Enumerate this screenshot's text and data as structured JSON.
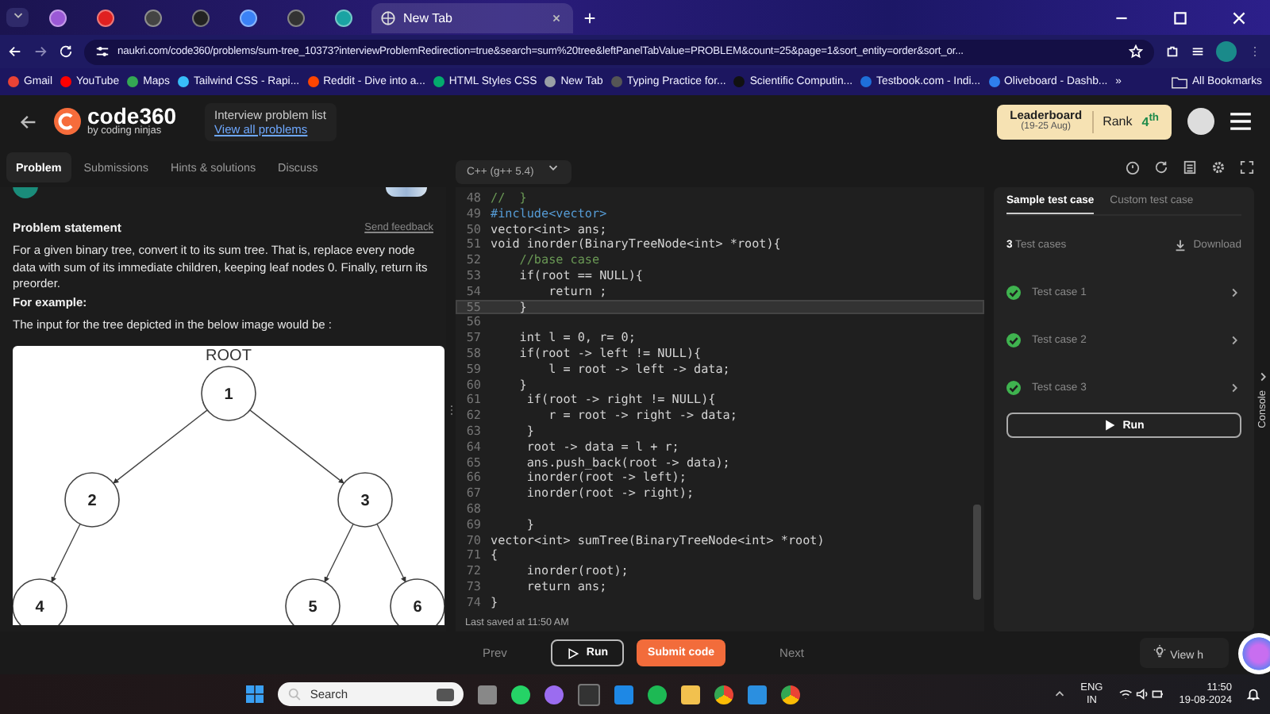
{
  "browser": {
    "tabs": [
      {
        "kind": "pinned",
        "color": "#9b59d6",
        "selected": false
      },
      {
        "kind": "pinned",
        "color": "#e02020",
        "selected": false
      },
      {
        "kind": "pinned",
        "color": "#444444",
        "selected": false
      },
      {
        "kind": "pinned",
        "color": "#222222",
        "selected": false
      },
      {
        "kind": "pinned",
        "color": "#3b82f6",
        "selected": false
      },
      {
        "kind": "pinned",
        "color": "#333333",
        "selected": false
      },
      {
        "kind": "pinned",
        "color": "#1aa3a3",
        "selected": false
      },
      {
        "kind": "page",
        "title": "New Tab",
        "selected": true
      }
    ],
    "url": "naukri.com/code360/problems/sum-tree_10373?interviewProblemRedirection=true&search=sum%20tree&leftPanelTabValue=PROBLEM&count=25&page=1&sort_entity=order&sort_or...",
    "bookmarks": [
      {
        "label": "Gmail",
        "color": "#ea4335"
      },
      {
        "label": "YouTube",
        "color": "#ff0000"
      },
      {
        "label": "Maps",
        "color": "#34a853"
      },
      {
        "label": "Tailwind CSS - Rapi...",
        "color": "#38bdf8"
      },
      {
        "label": "Reddit - Dive into a...",
        "color": "#ff4500"
      },
      {
        "label": "HTML Styles CSS",
        "color": "#04aa6d"
      },
      {
        "label": "New Tab",
        "color": "#9aa0a6"
      },
      {
        "label": "Typing Practice for...",
        "color": "#555555"
      },
      {
        "label": "Scientific Computin...",
        "color": "#111111"
      },
      {
        "label": "Testbook.com - Indi...",
        "color": "#1e6fd9"
      },
      {
        "label": "Oliveboard - Dashb...",
        "color": "#2f80ed"
      }
    ],
    "more": "»",
    "all_bookmarks": "All Bookmarks"
  },
  "header": {
    "logo_main": "code",
    "logo_num": "360",
    "logo_sub": "by coding ninjas",
    "breadcrumb": "Interview problem list",
    "link": "View all problems",
    "leaderboard": "Leaderboard",
    "dates": "(19-25 Aug)",
    "rank_label": "Rank",
    "rank": "4$^{th}$"
  },
  "left_tabs": [
    {
      "label": "Problem",
      "selected": true
    },
    {
      "label": "Submissions",
      "selected": false
    },
    {
      "label": "Hints & solutions",
      "selected": false
    },
    {
      "label": "Discuss",
      "selected": false
    }
  ],
  "problem": {
    "heading": "Problem statement",
    "feedback": "Send feedback",
    "body": "For a given binary tree, convert it to its sum tree. That is, replace every node data with sum of its immediate children, keeping leaf nodes 0. Finally, return its preorder.",
    "example_heading": "For example:",
    "example_text": "The input for the tree depicted in the below image would be :",
    "tree_caption": "ROOT",
    "tree": {
      "label": "1",
      "children": [
        {
          "label": "2",
          "children": [
            {
              "label": "4"
            }
          ]
        },
        {
          "label": "3",
          "children": [
            {
              "label": "5"
            },
            {
              "label": "6"
            }
          ]
        }
      ]
    }
  },
  "editor": {
    "language": "C++ (g++ 5.4)",
    "lines": [
      {
        "n": "48",
        "text": "//  }",
        "kind": "comment",
        "current": false
      },
      {
        "n": "49",
        "text": "#include<vector>",
        "kind": "directive",
        "current": false
      },
      {
        "n": "50",
        "text": "vector<int> ans;",
        "kind": "code",
        "current": false
      },
      {
        "n": "51",
        "text": "void inorder(BinaryTreeNode<int> *root){",
        "kind": "code",
        "current": false
      },
      {
        "n": "52",
        "text": "    //base case",
        "kind": "comment",
        "current": false
      },
      {
        "n": "53",
        "text": "    if(root == NULL){",
        "kind": "code",
        "current": false
      },
      {
        "n": "54",
        "text": "        return ;",
        "kind": "code",
        "current": false
      },
      {
        "n": "55",
        "text": "    }",
        "kind": "code",
        "current": true
      },
      {
        "n": "56",
        "kind": "code",
        "current": false
      },
      {
        "n": "57",
        "text": "    int l = 0, r= 0;",
        "kind": "code",
        "current": false
      },
      {
        "n": "58",
        "text": "    if(root -> left != NULL){",
        "kind": "code",
        "current": false
      },
      {
        "n": "59",
        "text": "        l = root -> left -> data;",
        "kind": "code",
        "current": false
      },
      {
        "n": "60",
        "text": "    }",
        "kind": "code",
        "current": false
      },
      {
        "n": "61",
        "text": "     if(root -> right != NULL){",
        "kind": "code",
        "current": false
      },
      {
        "n": "62",
        "text": "        r = root -> right -> data;",
        "kind": "code",
        "current": false
      },
      {
        "n": "63",
        "text": "     }",
        "kind": "code",
        "current": false
      },
      {
        "n": "64",
        "text": "     root -> data = l + r;",
        "kind": "code",
        "current": false
      },
      {
        "n": "65",
        "text": "     ans.push_back(root -> data);",
        "kind": "code",
        "current": false
      },
      {
        "n": "66",
        "text": "     inorder(root -> left);",
        "kind": "code",
        "current": false
      },
      {
        "n": "67",
        "text": "     inorder(root -> right);",
        "kind": "code",
        "current": false
      },
      {
        "n": "68",
        "kind": "code",
        "current": false
      },
      {
        "n": "69",
        "text": "     }",
        "kind": "code",
        "current": false
      },
      {
        "n": "70",
        "text": "vector<int> sumTree(BinaryTreeNode<int> *root)",
        "kind": "code",
        "current": false
      },
      {
        "n": "71",
        "text": "{",
        "kind": "code",
        "current": false
      },
      {
        "n": "72",
        "text": "     inorder(root);",
        "kind": "code",
        "current": false
      },
      {
        "n": "73",
        "text": "     return ans;",
        "kind": "code",
        "current": false
      },
      {
        "n": "74",
        "text": "}",
        "kind": "code",
        "current": false
      }
    ],
    "saved": "Last saved at 11:50 AM"
  },
  "tests": {
    "tabs": [
      {
        "label": "Sample test case",
        "selected": true
      },
      {
        "label": "Custom test case",
        "selected": false
      }
    ],
    "count": "**3** Test cases",
    "download": "Download",
    "cases": [
      {
        "label": "Test case 1",
        "passed": true
      },
      {
        "label": "Test case 2",
        "passed": true
      },
      {
        "label": "Test case 3",
        "passed": true
      }
    ],
    "run": "Run",
    "console": "Console"
  },
  "bottom": {
    "prev": "Prev",
    "run": "Run",
    "submit": "Submit code",
    "next": "Next",
    "hint": "View h"
  },
  "taskbar": {
    "search": "Search",
    "lang": "ENG",
    "region": "IN",
    "time": "11:50",
    "date": "19-08-2024"
  }
}
